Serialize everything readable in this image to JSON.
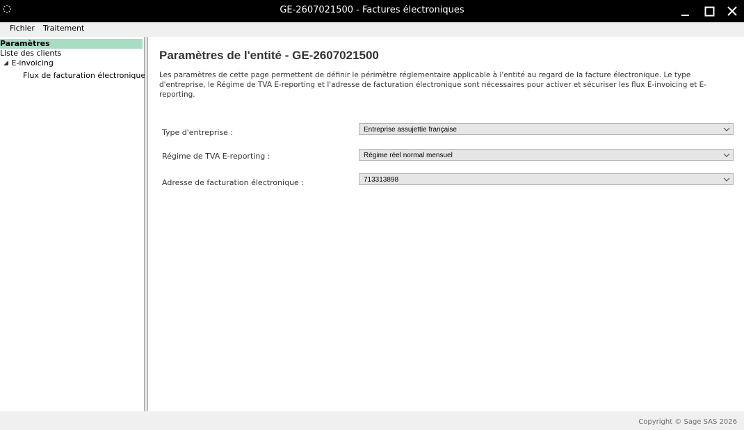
{
  "window": {
    "title": "GE-2607021500 - Factures électroniques"
  },
  "menu": {
    "items": [
      {
        "label": "Fichier"
      },
      {
        "label": "Traitement"
      }
    ]
  },
  "sidebar": {
    "items": [
      {
        "label": "Paramètres",
        "selected": true
      },
      {
        "label": "Liste des clients"
      },
      {
        "label": "E-invoicing",
        "expanded": true
      },
      {
        "label": "Flux de facturation électronique"
      }
    ]
  },
  "main": {
    "title": "Paramètres de l'entité - GE-2607021500",
    "description": "Les paramètres de cette page permettent de définir le périmètre réglementaire applicable à l'entité au regard de la facture électronique. Le type d'entreprise, le Régime de TVA E-reporting et l'adresse de facturation électronique sont nécessaires pour activer et sécuriser les flux E-invoicing et E-reporting.",
    "fields": [
      {
        "label": "Type d'entreprise :",
        "value": "Entreprise assujettie française"
      },
      {
        "label": "Régime de TVA E-reporting :",
        "value": "Régime réel normal mensuel"
      },
      {
        "label": "Adresse de facturation électronique :",
        "value": "713313898"
      }
    ]
  },
  "footer": {
    "copyright": "Copyright © Sage SAS 2026"
  },
  "icons": {
    "app": "loading-spinner-icon",
    "minimize": "minimize-icon",
    "maximize": "maximize-icon",
    "close": "close-icon",
    "tree_toggle": "tree-expanded-triangle-icon",
    "dropdown": "chevron-down-icon"
  },
  "colors": {
    "titlebar_bg": "#000000",
    "selected_bg": "#a8dcc3",
    "window_bg": "#f0f0f0"
  }
}
